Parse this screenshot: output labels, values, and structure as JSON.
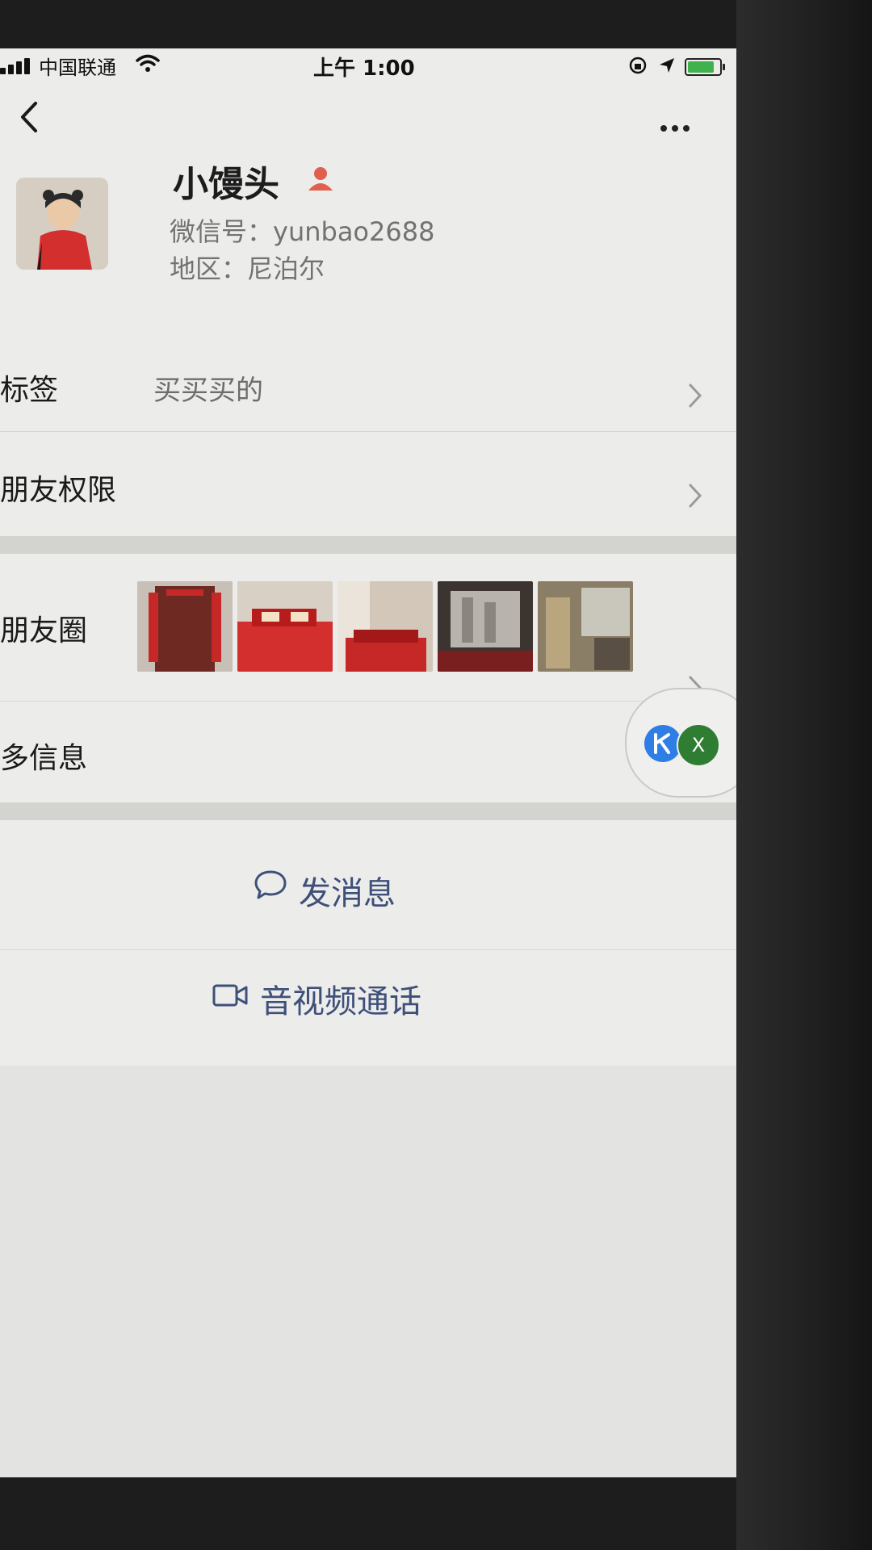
{
  "status_bar": {
    "carrier": "中国联通",
    "time": "上午 1:00",
    "battery_level": 0.85
  },
  "nav": {
    "back_icon": "chevron-left-icon",
    "more_icon": "more-dots-icon"
  },
  "profile": {
    "name": "小馒头",
    "wechat_id": "微信号：yunbao2688",
    "region": "地区：尼泊尔",
    "gender_icon": "female-icon"
  },
  "rows": {
    "tags_label": "标签",
    "tags_value": "买买买的",
    "permissions_label": "朋友权限",
    "moments_label": "朋友圈",
    "more_info_label": "多信息"
  },
  "moments_thumbnails": [
    "door-photo",
    "red-bed-photo",
    "bedroom-photo",
    "window-photo",
    "room-photo"
  ],
  "floating": {
    "app_badge": "X"
  },
  "actions": {
    "message_label": "发消息",
    "call_label": "音视频通话"
  },
  "colors": {
    "link_blue": "#3e4f7a",
    "background": "#ececea",
    "accent_red": "#d9534f"
  }
}
